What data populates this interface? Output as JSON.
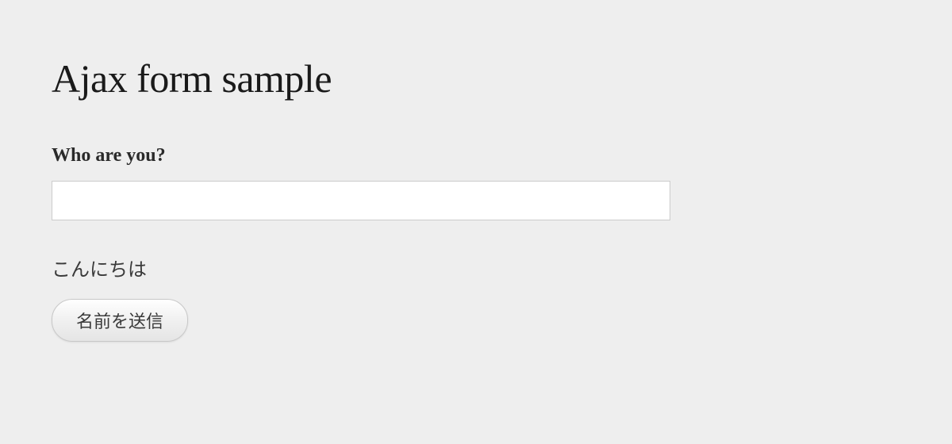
{
  "page": {
    "title": "Ajax form sample"
  },
  "form": {
    "label": "Who are you?",
    "input_value": "",
    "input_placeholder": "",
    "greeting": "こんにちは",
    "submit_label": "名前を送信"
  }
}
